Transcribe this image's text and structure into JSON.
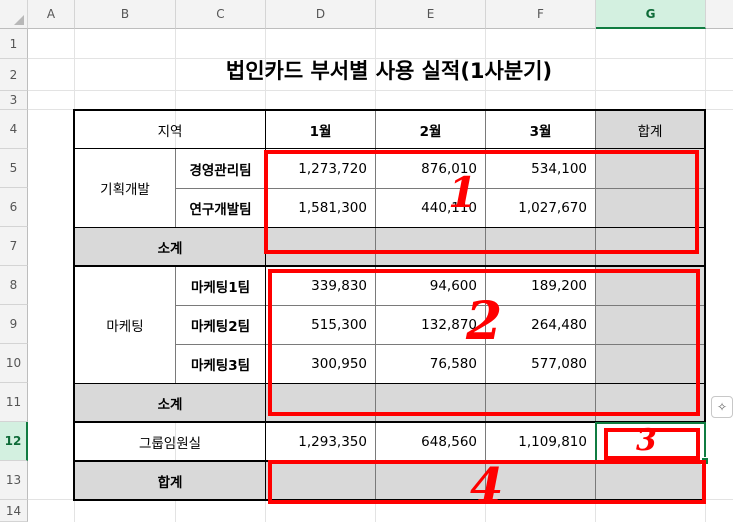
{
  "columns": [
    "A",
    "B",
    "C",
    "D",
    "E",
    "F",
    "G"
  ],
  "rows": [
    "1",
    "2",
    "3",
    "4",
    "5",
    "6",
    "7",
    "8",
    "9",
    "10",
    "11",
    "12",
    "13",
    "14"
  ],
  "active": {
    "column": "G",
    "row": "12"
  },
  "title": "법인카드 부서별 사용 실적(1사분기)",
  "header": {
    "region": "지역",
    "m1": "1월",
    "m2": "2월",
    "m3": "3월",
    "total": "합계"
  },
  "groups": [
    {
      "region": "기획개발",
      "teams": [
        {
          "name": "경영관리팀",
          "m1": "1,273,720",
          "m2": "876,010",
          "m3": "534,100"
        },
        {
          "name": "연구개발팀",
          "m1": "1,581,300",
          "m2": "440,110",
          "m3": "1,027,670"
        }
      ],
      "subtotal_label": "소계"
    },
    {
      "region": "마케팅",
      "teams": [
        {
          "name": "마케팅1팀",
          "m1": "339,830",
          "m2": "94,600",
          "m3": "189,200"
        },
        {
          "name": "마케팅2팀",
          "m1": "515,300",
          "m2": "132,870",
          "m3": "264,480"
        },
        {
          "name": "마케팅3팀",
          "m1": "300,950",
          "m2": "76,580",
          "m3": "577,080"
        }
      ],
      "subtotal_label": "소계"
    }
  ],
  "executive": {
    "label": "그룹임원실",
    "m1": "1,293,350",
    "m2": "648,560",
    "m3": "1,109,810"
  },
  "grand_total_label": "합계",
  "annotations": [
    "1",
    "2",
    "3",
    "4"
  ],
  "colors": {
    "annotation": "#ff0000",
    "shade": "#d9d9d9",
    "selection": "#107c41"
  },
  "icons": {
    "quick_analysis": "sparkle-icon"
  }
}
